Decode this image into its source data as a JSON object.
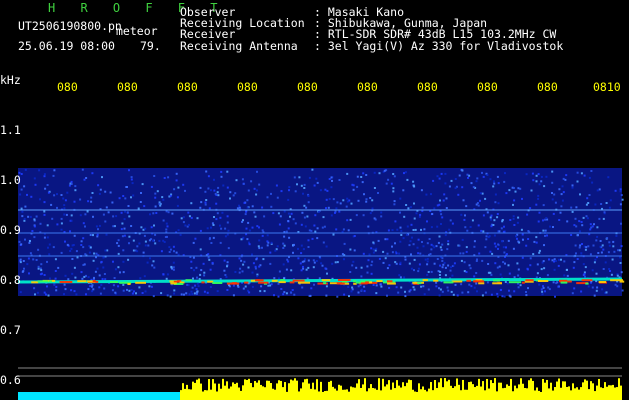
{
  "header": {
    "title": "H R O F F T",
    "filename": "UT2506190800.pn",
    "mode": "meteor",
    "timestamp": "25.06.19 08:00",
    "count": "79.",
    "info": [
      {
        "label": "Observer",
        "value": ": Masaki Kano"
      },
      {
        "label": "Receiving Location",
        "value": ": Shibukawa, Gunma, Japan"
      },
      {
        "label": "Receiver",
        "value": ": RTL-SDR SDR# 43dB L15 103.2MHz CW"
      },
      {
        "label": "Receiving Antenna",
        "value": ": 3el Yagi(V) Az 330 for Vladivostok"
      }
    ]
  },
  "axis": {
    "unit": "kHz",
    "x_ticks": [
      "080",
      "080",
      "080",
      "080",
      "080",
      "080",
      "080",
      "080",
      "080",
      "0810"
    ],
    "y_ticks": [
      "1.1",
      "1.0",
      "0.9",
      "0.8",
      "0.7",
      "0.6"
    ]
  },
  "colors": {
    "tick_time": "#ffff00",
    "spectrum_bg": "#0a1a9a",
    "signal": "#ff3300",
    "level_bar": "#ffff00",
    "level_base": "#00e5ff"
  }
}
